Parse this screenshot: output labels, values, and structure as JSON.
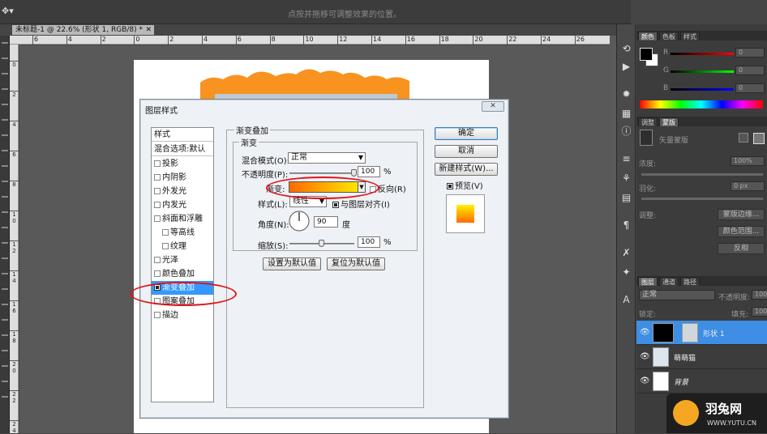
{
  "options_bar": {
    "hint": "点按并拖移可调整效果的位置。"
  },
  "document_tab": {
    "title": "未标题-1 @ 22.6% (形状 1, RGB/8) *",
    "close": "✕"
  },
  "rulers": {
    "horizontal": [
      "6",
      "4",
      "2",
      "0",
      "2",
      "4",
      "6",
      "8",
      "10",
      "12",
      "14",
      "16",
      "18",
      "20",
      "22",
      "24",
      "26"
    ],
    "vertical": [
      "0",
      "2",
      "4",
      "6",
      "8",
      "1\n0",
      "1\n2",
      "1\n4",
      "1\n6",
      "1\n8",
      "2\n0",
      "2\n2",
      "2\n4"
    ]
  },
  "dialog": {
    "title": "图层样式",
    "close": "✕",
    "style_list": {
      "header": "样式",
      "blend_default": "混合选项:默认",
      "items": [
        {
          "label": "投影",
          "checked": false,
          "indent": false
        },
        {
          "label": "内阴影",
          "checked": false,
          "indent": false
        },
        {
          "label": "外发光",
          "checked": false,
          "indent": false
        },
        {
          "label": "内发光",
          "checked": false,
          "indent": false
        },
        {
          "label": "斜面和浮雕",
          "checked": false,
          "indent": false
        },
        {
          "label": "等高线",
          "checked": false,
          "indent": true
        },
        {
          "label": "纹理",
          "checked": false,
          "indent": true
        },
        {
          "label": "光泽",
          "checked": false,
          "indent": false
        },
        {
          "label": "颜色叠加",
          "checked": false,
          "indent": false
        },
        {
          "label": "渐变叠加",
          "checked": true,
          "indent": false,
          "selected": true
        },
        {
          "label": "图案叠加",
          "checked": false,
          "indent": false
        },
        {
          "label": "描边",
          "checked": false,
          "indent": false
        }
      ]
    },
    "gradient_overlay": {
      "group_title": "渐变叠加",
      "sub_title": "渐变",
      "blend_mode_label": "混合模式(O):",
      "blend_mode_value": "正常",
      "opacity_label": "不透明度(P):",
      "opacity_value": "100",
      "opacity_unit": "%",
      "opacity_level": 1.0,
      "gradient_label": "渐变:",
      "reverse_label": "反向(R)",
      "style_label": "样式(L):",
      "style_value": "线性",
      "align_label": "与图层对齐(I)",
      "angle_label": "角度(N):",
      "angle_value": "90",
      "angle_unit": "度",
      "scale_label": "缩放(S):",
      "scale_value": "100",
      "scale_unit": "%",
      "scale_level": 0.5,
      "set_default": "设置为默认值",
      "reset_default": "复位为默认值"
    },
    "buttons": {
      "ok": "确定",
      "cancel": "取消",
      "new_style": "新建样式(W)...",
      "preview": "预览(V)"
    },
    "colors": {
      "gradient_start": "#ff6a00",
      "gradient_end": "#fff200",
      "highlight": "#e1141a"
    }
  },
  "panels": {
    "color_tabs": [
      "颜色",
      "色板",
      "样式"
    ],
    "rgb_labels": [
      "R",
      "G",
      "B"
    ],
    "rgb_values": [
      "0",
      "0",
      "0"
    ],
    "adjust_tabs": [
      "调整",
      "蒙版"
    ],
    "mask": {
      "title": "矢量蒙版",
      "density_label": "浓度:",
      "density_value": "100%",
      "feather_label": "羽化:",
      "feather_value": "0 px",
      "refine_label": "调整:",
      "mask_edge": "蒙版边缘...",
      "color_range": "颜色范围...",
      "invert": "反相"
    },
    "layers_tabs": [
      "图层",
      "通道",
      "路径"
    ],
    "layers": {
      "blend": "正常",
      "opacity_label": "不透明度:",
      "opacity_value": "100",
      "lock_label": "锁定:",
      "fill_label": "填充:",
      "fill_value": "100",
      "items": [
        {
          "name": "形状 1",
          "selected": true
        },
        {
          "name": "萌萌猫",
          "selected": false
        },
        {
          "name": "背景",
          "selected": false
        }
      ]
    }
  },
  "watermark": {
    "name": "羽兔网",
    "url": "WWW.YUTU.CN"
  }
}
